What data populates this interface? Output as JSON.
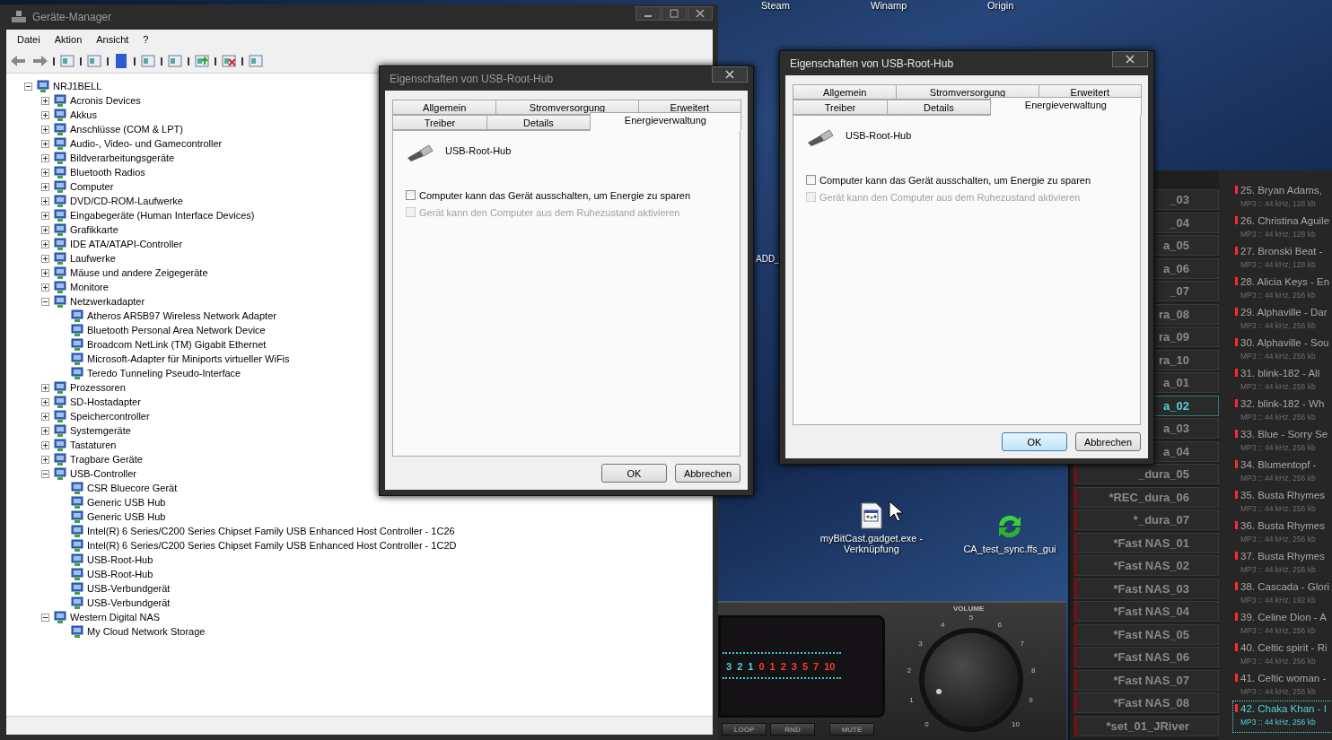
{
  "desktop": {
    "top_icons": [
      {
        "label": "Steam"
      },
      {
        "label": "Winamp"
      },
      {
        "label": "Origin"
      }
    ],
    "edge_text": "ADD_",
    "shortcuts": [
      {
        "label": "myBitCast.gadget.exe - Verknüpfung",
        "kind": "gadget"
      },
      {
        "label": "CA_test_sync.ffs_gui",
        "kind": "sync"
      }
    ]
  },
  "device_manager": {
    "title": "Geräte-Manager",
    "menu": [
      "Datei",
      "Aktion",
      "Ansicht",
      "?"
    ],
    "tree": {
      "label": "NRJ1BELL",
      "expanded": true,
      "children": [
        {
          "label": "Acronis Devices",
          "expanded": false
        },
        {
          "label": "Akkus",
          "expanded": false
        },
        {
          "label": "Anschlüsse (COM & LPT)",
          "expanded": false
        },
        {
          "label": "Audio-, Video- und Gamecontroller",
          "expanded": false
        },
        {
          "label": "Bildverarbeitungsgeräte",
          "expanded": false
        },
        {
          "label": "Bluetooth Radios",
          "expanded": false
        },
        {
          "label": "Computer",
          "expanded": false
        },
        {
          "label": "DVD/CD-ROM-Laufwerke",
          "expanded": false
        },
        {
          "label": "Eingabegeräte (Human Interface Devices)",
          "expanded": false
        },
        {
          "label": "Grafikkarte",
          "expanded": false
        },
        {
          "label": "IDE ATA/ATAPI-Controller",
          "expanded": false
        },
        {
          "label": "Laufwerke",
          "expanded": false
        },
        {
          "label": "Mäuse und andere Zeigegeräte",
          "expanded": false
        },
        {
          "label": "Monitore",
          "expanded": false
        },
        {
          "label": "Netzwerkadapter",
          "expanded": true,
          "children": [
            {
              "label": "Atheros AR5B97 Wireless Network Adapter"
            },
            {
              "label": "Bluetooth Personal Area Network Device"
            },
            {
              "label": "Broadcom NetLink (TM) Gigabit Ethernet"
            },
            {
              "label": "Microsoft-Adapter für Miniports virtueller WiFis"
            },
            {
              "label": "Teredo Tunneling Pseudo-Interface"
            }
          ]
        },
        {
          "label": "Prozessoren",
          "expanded": false
        },
        {
          "label": "SD-Hostadapter",
          "expanded": false
        },
        {
          "label": "Speichercontroller",
          "expanded": false
        },
        {
          "label": "Systemgeräte",
          "expanded": false
        },
        {
          "label": "Tastaturen",
          "expanded": false
        },
        {
          "label": "Tragbare Geräte",
          "expanded": false
        },
        {
          "label": "USB-Controller",
          "expanded": true,
          "children": [
            {
              "label": "CSR Bluecore Gerät"
            },
            {
              "label": "Generic USB Hub"
            },
            {
              "label": "Generic USB Hub"
            },
            {
              "label": "Intel(R) 6 Series/C200 Series Chipset Family USB Enhanced Host Controller - 1C26"
            },
            {
              "label": "Intel(R) 6 Series/C200 Series Chipset Family USB Enhanced Host Controller - 1C2D"
            },
            {
              "label": "USB-Root-Hub"
            },
            {
              "label": "USB-Root-Hub"
            },
            {
              "label": "USB-Verbundgerät"
            },
            {
              "label": "USB-Verbundgerät"
            }
          ]
        },
        {
          "label": "Western Digital NAS",
          "expanded": true,
          "children": [
            {
              "label": "My Cloud Network Storage"
            }
          ]
        }
      ]
    }
  },
  "dialogs": [
    {
      "title": "Eigenschaften von USB-Root-Hub",
      "active": false,
      "tab_rows": [
        [
          {
            "label": "Allgemein",
            "selected": false
          },
          {
            "label": "Stromversorgung",
            "selected": false
          },
          {
            "label": "Erweitert",
            "selected": false
          }
        ],
        [
          {
            "label": "Treiber",
            "selected": false
          },
          {
            "label": "Details",
            "selected": false
          },
          {
            "label": "Energieverwaltung",
            "selected": true
          }
        ]
      ],
      "device": "USB-Root-Hub",
      "options": [
        {
          "label": "Computer kann das Gerät ausschalten, um Energie zu sparen",
          "checked": false,
          "disabled": false
        },
        {
          "label": "Gerät kann den Computer aus dem Ruhezustand aktivieren",
          "checked": false,
          "disabled": true
        }
      ],
      "buttons": [
        {
          "label": "OK",
          "focused": false
        },
        {
          "label": "Abbrechen",
          "focused": false
        }
      ]
    },
    {
      "title": "Eigenschaften von USB-Root-Hub",
      "active": true,
      "tab_rows": [
        [
          {
            "label": "Allgemein",
            "selected": false
          },
          {
            "label": "Stromversorgung",
            "selected": false
          },
          {
            "label": "Erweitert",
            "selected": false
          }
        ],
        [
          {
            "label": "Treiber",
            "selected": false
          },
          {
            "label": "Details",
            "selected": false
          },
          {
            "label": "Energieverwaltung",
            "selected": true
          }
        ]
      ],
      "device": "USB-Root-Hub",
      "options": [
        {
          "label": "Computer kann das Gerät ausschalten, um Energie zu sparen",
          "checked": false,
          "disabled": false
        },
        {
          "label": "Gerät kann den Computer aus dem Ruhezustand aktivieren",
          "checked": false,
          "disabled": true
        }
      ],
      "buttons": [
        {
          "label": "OK",
          "focused": true
        },
        {
          "label": "Abbrechen",
          "focused": false
        }
      ]
    }
  ],
  "player": {
    "meter_scale": [
      {
        "label": "3",
        "color": "#4fd4dc"
      },
      {
        "label": "2",
        "color": "#4fd4dc"
      },
      {
        "label": "1",
        "color": "#4fd4dc"
      },
      {
        "label": "0",
        "color": "#ff3b30"
      },
      {
        "label": "1",
        "color": "#ff3b30"
      },
      {
        "label": "2",
        "color": "#ff3b30"
      },
      {
        "label": "3",
        "color": "#ff3b30"
      },
      {
        "label": "5",
        "color": "#ff3b30"
      },
      {
        "label": "7",
        "color": "#ff3b30"
      },
      {
        "label": "10",
        "color": "#ff3b30"
      }
    ],
    "buttons": [
      "LOOP",
      "RND",
      "MUTE"
    ],
    "volume": {
      "label": "VOLUME",
      "level": 0.09,
      "ticks": [
        "0",
        "1",
        "2",
        "3",
        "4",
        "5",
        "6",
        "7",
        "8",
        "9",
        "10"
      ]
    }
  },
  "playlists": [
    {
      "label": "_03",
      "selected": false
    },
    {
      "label": "_04",
      "selected": false
    },
    {
      "label": "a_05",
      "selected": false
    },
    {
      "label": "a_06",
      "selected": false
    },
    {
      "label": "_07",
      "selected": false
    },
    {
      "label": "ra_08",
      "selected": false
    },
    {
      "label": "ra_09",
      "selected": false
    },
    {
      "label": "ra_10",
      "selected": false
    },
    {
      "label": "a_01",
      "selected": false
    },
    {
      "label": "a_02",
      "selected": true
    },
    {
      "label": "a_03",
      "selected": false
    },
    {
      "label": "a_04",
      "selected": false
    },
    {
      "label": "_dura_05",
      "selected": false
    },
    {
      "label": "*REC_dura_06",
      "selected": false
    },
    {
      "label": "*_dura_07",
      "selected": false
    },
    {
      "label": "*Fast NAS_01",
      "selected": false
    },
    {
      "label": "*Fast NAS_02",
      "selected": false
    },
    {
      "label": "*Fast NAS_03",
      "selected": false
    },
    {
      "label": "*Fast NAS_04",
      "selected": false
    },
    {
      "label": "*Fast NAS_05",
      "selected": false
    },
    {
      "label": "*Fast NAS_06",
      "selected": false
    },
    {
      "label": "*Fast NAS_07",
      "selected": false
    },
    {
      "label": "*Fast NAS_08",
      "selected": false
    },
    {
      "label": "*set_01_JRiver",
      "selected": false
    }
  ],
  "tracks": [
    {
      "title": "25. Bryan Adams,",
      "info": "MP3 :: 44 kHz, 128 kb",
      "selected": false
    },
    {
      "title": "26. Christina Aguile",
      "info": "MP3 :: 44 kHz, 128 kb",
      "selected": false
    },
    {
      "title": "27. Bronski Beat -",
      "info": "MP3 :: 44 kHz, 128 kb",
      "selected": false
    },
    {
      "title": "28. Alicia Keys - En",
      "info": "MP3 :: 44 kHz, 256 kb",
      "selected": false
    },
    {
      "title": "29. Alphaville - Dar",
      "info": "MP3 :: 44 kHz, 256 kb",
      "selected": false
    },
    {
      "title": "30. Alphaville - Sou",
      "info": "MP3 :: 44 kHz, 256 kb",
      "selected": false
    },
    {
      "title": "31. blink-182 - All",
      "info": "MP3 :: 44 kHz, 256 kb",
      "selected": false
    },
    {
      "title": "32. blink-182 - Wh",
      "info": "MP3 :: 44 kHz, 256 kb",
      "selected": false
    },
    {
      "title": "33. Blue - Sorry Se",
      "info": "MP3 :: 44 kHz, 256 kb",
      "selected": false
    },
    {
      "title": "34. Blumentopf -",
      "info": "MP3 :: 44 kHz, 256 kb",
      "selected": false
    },
    {
      "title": "35. Busta Rhymes",
      "info": "MP3 :: 44 kHz, 256 kb",
      "selected": false
    },
    {
      "title": "36. Busta Rhymes",
      "info": "MP3 :: 44 kHz, 256 kb",
      "selected": false
    },
    {
      "title": "37. Busta Rhymes",
      "info": "MP3 :: 44 kHz, 256 kb",
      "selected": false
    },
    {
      "title": "38. Cascada - Glori",
      "info": "MP3 :: 44 kHz, 192 kb",
      "selected": false
    },
    {
      "title": "39. Celine Dion - A",
      "info": "MP3 :: 44 kHz, 256 kb",
      "selected": false
    },
    {
      "title": "40. Celtic spirit - Ri",
      "info": "MP3 :: 44 kHz, 256 kb",
      "selected": false
    },
    {
      "title": "41. Celtic woman -",
      "info": "MP3 :: 44 kHz, 256 kb",
      "selected": false
    },
    {
      "title": "42. Chaka Khan - I",
      "info": "MP3 :: 44 kHz, 256 kb",
      "selected": true
    }
  ]
}
